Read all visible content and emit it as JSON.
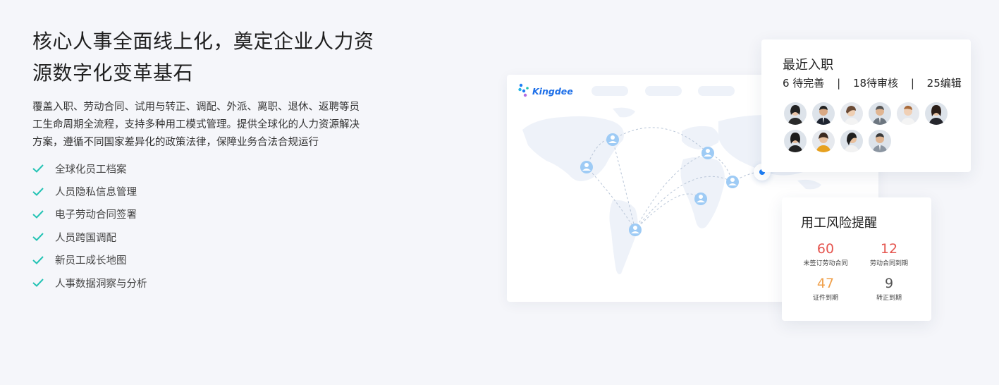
{
  "heading": {
    "line1": "核心人事全面线上化，奠定企业人力资",
    "line2": "源数字化变革基石"
  },
  "description": {
    "line1": "覆盖入职、劳动合同、试用与转正、调配、外派、离职、退休、返聘等员",
    "line2": "工生命周期全流程，支持多种用工模式管理。提供全球化的人力资源解决",
    "line3": "方案，遵循不同国家差异化的政策法律，保障业务合法合规运行"
  },
  "features": [
    "全球化员工档案",
    "人员隐私信息管理",
    "电子劳动合同签署",
    "人员跨国调配",
    "新员工成长地图",
    "人事数据洞察与分析"
  ],
  "brand": {
    "logo_text": "Kingdee"
  },
  "recent_onboarding": {
    "title": "最近入职",
    "stat1": "6 待完善",
    "stat2": "18待审核",
    "stat3": "25编辑",
    "separator": "|"
  },
  "risk_alert": {
    "title": "用工风险提醒",
    "items": [
      {
        "value": "60",
        "label": "未签订劳动合同",
        "color": "#e5554f"
      },
      {
        "value": "12",
        "label": "劳动合同到期",
        "color": "#e5554f"
      },
      {
        "value": "47",
        "label": "证件到期",
        "color": "#f0a04b"
      },
      {
        "value": "9",
        "label": "转正到期",
        "color": "#555555"
      }
    ]
  },
  "colors": {
    "accent": "#1d7ef5",
    "check": "#23c3b4",
    "map_land": "#eef2f9",
    "pin": "#9ecbf5"
  },
  "icons": {
    "check": "check-icon",
    "pin": "user-pin-icon"
  }
}
